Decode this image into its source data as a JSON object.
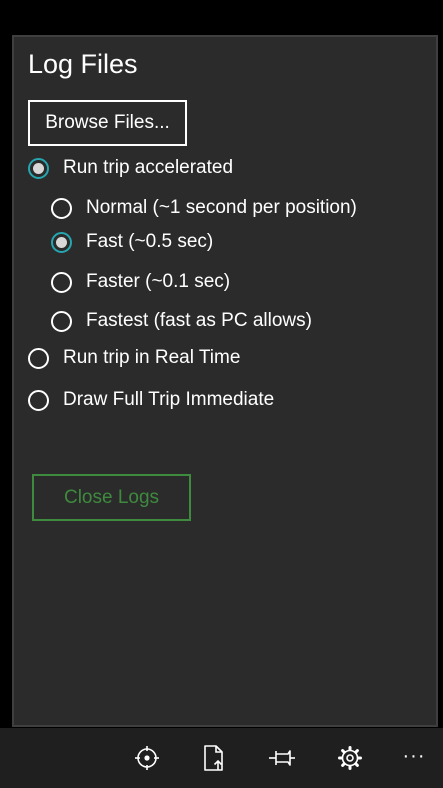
{
  "panel": {
    "title": "Log Files",
    "browse_button_label": "Browse Files...",
    "options": [
      {
        "label": "Run trip accelerated",
        "checked": true
      },
      {
        "label": "Normal (~1 second per position)",
        "checked": false
      },
      {
        "label": "Fast (~0.5 sec)",
        "checked": true
      },
      {
        "label": "Faster (~0.1 sec)",
        "checked": false
      },
      {
        "label": "Fastest (fast as PC allows)",
        "checked": false
      },
      {
        "label": "Run trip in Real Time",
        "checked": false
      },
      {
        "label": "Draw Full Trip Immediate",
        "checked": false
      }
    ],
    "close_button_label": "Close Logs"
  },
  "app_bar": {
    "icons": [
      "target-icon",
      "file-export-icon",
      "pin-icon",
      "settings-gear-icon"
    ],
    "more_label": "···"
  },
  "colors": {
    "panel_bg": "#2b2b2b",
    "accent_radio": "#26a6b0",
    "close_button": "#3e8a3e",
    "app_bar_bg": "#1f1f1f"
  }
}
